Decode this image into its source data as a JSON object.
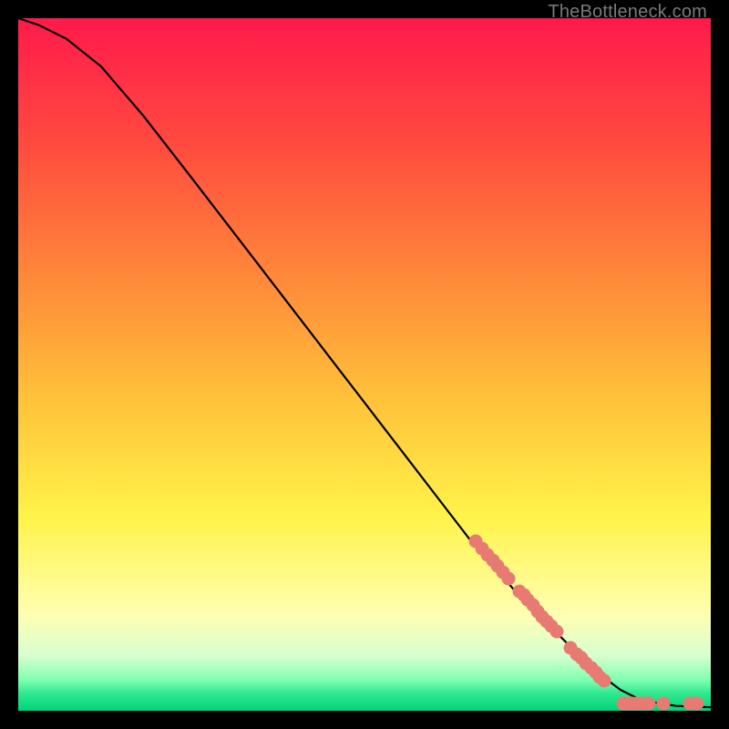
{
  "attribution": "TheBottleneck.com",
  "colors": {
    "bg": "#000000",
    "dot": "#e77b74",
    "curve": "#000000",
    "gradient_top": "#ff1a4b",
    "gradient_mid_orange": "#ff9a3a",
    "gradient_yellow": "#fff34a",
    "gradient_pale_yellow": "#ffffb0",
    "gradient_mint": "#6bff9e",
    "gradient_green": "#00d37a"
  },
  "chart_data": {
    "type": "line",
    "title": "",
    "xlabel": "",
    "ylabel": "",
    "xlim": [
      0,
      100
    ],
    "ylim": [
      0,
      100
    ],
    "curve": [
      {
        "x": 0,
        "y": 100
      },
      {
        "x": 3,
        "y": 99
      },
      {
        "x": 7,
        "y": 97
      },
      {
        "x": 12,
        "y": 93
      },
      {
        "x": 18,
        "y": 86
      },
      {
        "x": 25,
        "y": 77
      },
      {
        "x": 35,
        "y": 64
      },
      {
        "x": 45,
        "y": 51
      },
      {
        "x": 55,
        "y": 38
      },
      {
        "x": 65,
        "y": 25
      },
      {
        "x": 72,
        "y": 17
      },
      {
        "x": 78,
        "y": 11
      },
      {
        "x": 83,
        "y": 6
      },
      {
        "x": 87,
        "y": 3
      },
      {
        "x": 90,
        "y": 1.5
      },
      {
        "x": 95,
        "y": 0.7
      },
      {
        "x": 100,
        "y": 0.5
      }
    ],
    "scatter": [
      {
        "x": 66.0,
        "y": 24.5
      },
      {
        "x": 67.0,
        "y": 23.4
      },
      {
        "x": 67.8,
        "y": 22.5
      },
      {
        "x": 68.5,
        "y": 21.7
      },
      {
        "x": 69.2,
        "y": 20.9
      },
      {
        "x": 70.0,
        "y": 20.0
      },
      {
        "x": 70.8,
        "y": 19.1
      },
      {
        "x": 72.4,
        "y": 17.3
      },
      {
        "x": 73.0,
        "y": 16.7
      },
      {
        "x": 73.6,
        "y": 16.0
      },
      {
        "x": 74.3,
        "y": 15.2
      },
      {
        "x": 75.0,
        "y": 14.4
      },
      {
        "x": 75.7,
        "y": 13.6
      },
      {
        "x": 76.3,
        "y": 12.9
      },
      {
        "x": 77.0,
        "y": 12.2
      },
      {
        "x": 77.7,
        "y": 11.4
      },
      {
        "x": 79.8,
        "y": 9.1
      },
      {
        "x": 80.7,
        "y": 8.2
      },
      {
        "x": 81.3,
        "y": 7.6
      },
      {
        "x": 82.0,
        "y": 6.9
      },
      {
        "x": 82.7,
        "y": 6.2
      },
      {
        "x": 83.4,
        "y": 5.5
      },
      {
        "x": 84.0,
        "y": 4.9
      },
      {
        "x": 84.6,
        "y": 4.3
      },
      {
        "x": 87.4,
        "y": 1.1
      },
      {
        "x": 88.0,
        "y": 1.1
      },
      {
        "x": 88.7,
        "y": 1.1
      },
      {
        "x": 89.4,
        "y": 1.1
      },
      {
        "x": 90.2,
        "y": 1.1
      },
      {
        "x": 91.0,
        "y": 1.1
      },
      {
        "x": 93.2,
        "y": 1.1
      },
      {
        "x": 97.0,
        "y": 1.1
      },
      {
        "x": 98.0,
        "y": 1.1
      }
    ],
    "gradient_stops": [
      {
        "offset": 0.0,
        "color": "#ff1a4b"
      },
      {
        "offset": 0.18,
        "color": "#ff4a3f"
      },
      {
        "offset": 0.38,
        "color": "#ff8a3a"
      },
      {
        "offset": 0.55,
        "color": "#ffc23a"
      },
      {
        "offset": 0.72,
        "color": "#fff34a"
      },
      {
        "offset": 0.86,
        "color": "#ffffb0"
      },
      {
        "offset": 0.92,
        "color": "#d8ffd0"
      },
      {
        "offset": 0.955,
        "color": "#80ffb0"
      },
      {
        "offset": 0.975,
        "color": "#30e890"
      },
      {
        "offset": 1.0,
        "color": "#00d37a"
      }
    ]
  }
}
